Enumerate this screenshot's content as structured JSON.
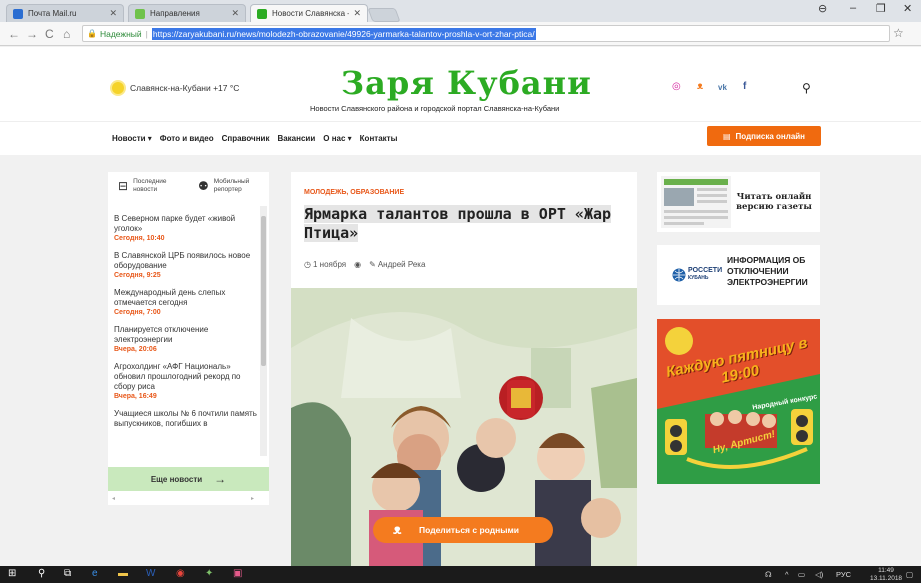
{
  "browser": {
    "tabs": [
      {
        "label": "Почта Mail.ru",
        "color": "#2a6dd1"
      },
      {
        "label": "Направления",
        "color": "#6fc24a"
      },
      {
        "label": "Новости Славянска – Р",
        "color": "#2cab23"
      }
    ],
    "address": {
      "secure_label": "Надежный",
      "url": "https://zaryakubani.ru/news/molodezh-obrazovanie/49926-yarmarka-talantov-proshla-v-ort-zhar-ptica/"
    }
  },
  "site": {
    "weather": "Славянск-на-Кубани +17 °C",
    "logo": "Заря Кубани",
    "tagline": "Новости Славянского района и городской портал Славянска-на-Кубани",
    "nav": [
      "Новости ▾",
      "Фото и видео",
      "Справочник",
      "Вакансии",
      "О нас ▾",
      "Контакты"
    ],
    "subscribe": "Подписка онлайн"
  },
  "sidebar": {
    "tab_latest": "Последние новости",
    "tab_reporter": "Мобильный репортер",
    "items": [
      {
        "title": "В Северном парке будет «живой уголок»",
        "time": "Сегодня, 10:40"
      },
      {
        "title": "В Славянской ЦРБ появилось новое оборудование",
        "time": "Сегодня, 9:25"
      },
      {
        "title": "Международный день слепых отмечается сегодня",
        "time": "Сегодня, 7:00"
      },
      {
        "title": "Планируется отключение электроэнергии",
        "time": "Вчера, 20:06"
      },
      {
        "title": "Агрохолдинг «АФГ Националь» обновил прошлогодний рекорд по сбору риса",
        "time": "Вчера, 16:49"
      },
      {
        "title": "Учащиеся школы № 6 почтили память выпускников, погибших в",
        "time": ""
      }
    ],
    "more": "Еще новости"
  },
  "article": {
    "category": "МОЛОДЕЖЬ, ОБРАЗОВАНИЕ",
    "title": "Ярмарка талантов прошла в ОРТ «Жар Птица»",
    "date": "1 ноября",
    "author": "Андрей Река",
    "share": "Поделиться с родными"
  },
  "ads": {
    "paper": "Читать онлайн версию газеты",
    "rosseti_logo": "РОССЕТИ",
    "rosseti_sub": "КУБАНЬ",
    "rosseti": "ИНФОРМАЦИЯ ОБ ОТКЛЮЧЕНИИ ЭЛЕКТРОЭНЕРГИИ",
    "friday": "Каждую пятницу в 19:00",
    "contest": "Народный конкурс",
    "artist": "Ну, Артист!"
  },
  "taskbar": {
    "lang": "РУС",
    "time": "11:49",
    "date": "13.11.2018"
  }
}
